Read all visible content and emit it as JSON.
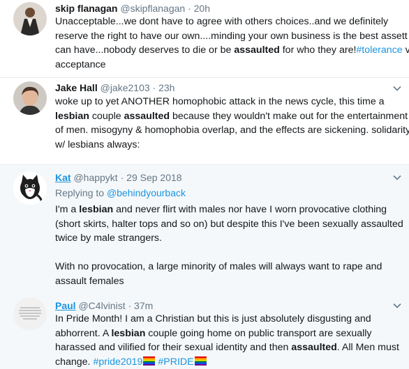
{
  "tweets": [
    {
      "name": "skip flanagan",
      "handle": "@skipflanagan",
      "sep": "·",
      "time": "20h",
      "lines": [
        "Unacceptable...we dont have to agree with others choices..and we definitely",
        "reserve the right to have our own....minding your own business is the best assett u",
        {
          "pre": "can have...nobody deserves to die or be ",
          "bold": "assaulted",
          "mid": " for who they are!",
          "tag": "#tolerance",
          "post": " vs"
        },
        "acceptance"
      ]
    },
    {
      "name": "Jake Hall",
      "handle": "@jake2103",
      "sep": "·",
      "time": "23h",
      "lines": [
        "woke up to yet ANOTHER homophobic attack in the news cycle, this time a",
        {
          "bold1": "lesbian",
          "mid": " couple ",
          "bold2": "assaulted",
          "post": " because they wouldn't make out for the entertainment"
        },
        "of men. misogyny & homophobia overlap, and the effects are sickening. solidarity",
        "w/ lesbians always:"
      ]
    },
    {
      "name": "Kat",
      "handle": "@happykt",
      "sep": "·",
      "time": "29 Sep 2018",
      "reply_prefix": "Replying to",
      "reply_to": "@behindyourback",
      "lines": [
        {
          "pre": "I'm a ",
          "bold": "lesbian",
          "post": " and never flirt with males nor have I worn provocative clothing"
        },
        "(short skirts, halter tops and so on) but despite this I've been sexually assaulted",
        "twice by male strangers.",
        "",
        "With no provocation, a large minority of males will always want to rape and",
        "assault females"
      ]
    },
    {
      "name": "Paul",
      "handle": "@C4lvinist",
      "sep": "·",
      "time": "37m",
      "lines": [
        "In Pride Month! I am a Christian but this is just absolutely disgusting and",
        {
          "pre": "abhorrent. A ",
          "bold": "lesbian",
          "post": " couple going home on public transport are sexually"
        },
        {
          "pre": "harassed and vilified for their sexual identity and then ",
          "bold": "assaulted",
          "post": ". All Men must"
        },
        {
          "pre": "change. ",
          "tag1": "#pride2019",
          "tag2": "#PRIDE"
        }
      ]
    }
  ],
  "colors": {
    "link": "#1b95e0",
    "muted": "#657786",
    "text": "#14171a",
    "highlight_bg": "#f5f8fa"
  },
  "icons": {
    "menu": "chevron-down-icon"
  }
}
